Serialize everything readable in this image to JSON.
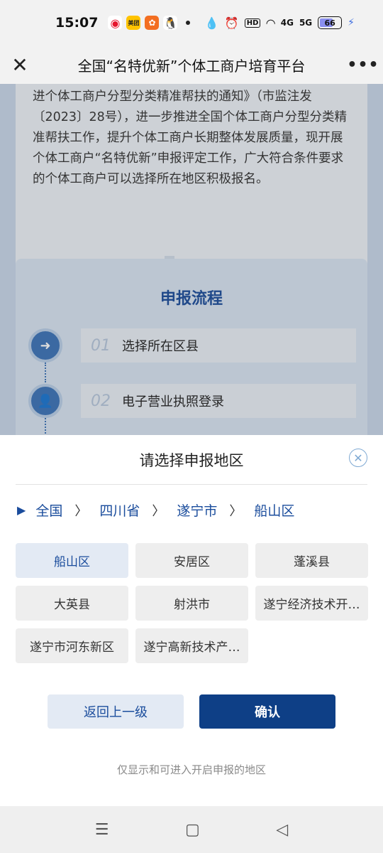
{
  "status_bar": {
    "time": "15:07",
    "apps": [
      "weibo",
      "美团",
      "orange-app",
      "qq"
    ],
    "meituan_label": "美团",
    "hd_label": "HD",
    "net_4g": "4G",
    "net_5g": "5G",
    "battery_level": 66,
    "battery_text": "66"
  },
  "nav": {
    "title": "全国“名特优新”个体工商户培育平台",
    "close_icon": "close-icon",
    "more_icon": "more-icon"
  },
  "page": {
    "notice_text": "进个体工商户分型分类精准帮扶的通知》（市监注发〔2023〕28号），进一步推进全国个体工商户分型分类精准帮扶工作，提升个体工商户长期整体发展质量，现开展个体工商户“名特优新”申报评定工作，广大符合条件要求的个体工商户可以选择所在地区积极报名。",
    "process_title": "申报流程",
    "steps": [
      {
        "num": "01",
        "label": "选择所在区县"
      },
      {
        "num": "02",
        "label": "电子营业执照登录"
      }
    ]
  },
  "sheet": {
    "title": "请选择申报地区",
    "breadcrumb": [
      "全国",
      "四川省",
      "遂宁市",
      "船山区"
    ],
    "regions": [
      {
        "label": "船山区",
        "selected": true
      },
      {
        "label": "安居区",
        "selected": false
      },
      {
        "label": "蓬溪县",
        "selected": false
      },
      {
        "label": "大英县",
        "selected": false
      },
      {
        "label": "射洪市",
        "selected": false
      },
      {
        "label": "遂宁经济技术开…",
        "selected": false
      },
      {
        "label": "遂宁市河东新区",
        "selected": false
      },
      {
        "label": "遂宁高新技术产…",
        "selected": false
      }
    ],
    "back_label": "返回上一级",
    "confirm_label": "确认",
    "footnote": "仅显示和可进入开启申报的地区"
  },
  "colors": {
    "accent": "#0e3f86",
    "link": "#1a4c9c",
    "selected_bg": "#e3eaf4"
  }
}
